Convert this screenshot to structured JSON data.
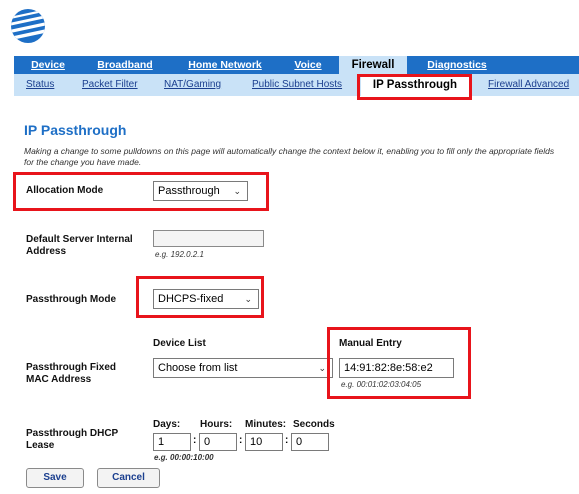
{
  "colors": {
    "brand": "#1e6fc6",
    "highlight": "#e8141b",
    "subnav_bg": "#c9e2f7"
  },
  "main_tabs": [
    {
      "label": "Device"
    },
    {
      "label": "Broadband"
    },
    {
      "label": "Home Network"
    },
    {
      "label": "Voice"
    },
    {
      "label": "Firewall",
      "active": true
    },
    {
      "label": "Diagnostics"
    }
  ],
  "sub_tabs": [
    {
      "label": "Status"
    },
    {
      "label": "Packet Filter"
    },
    {
      "label": "NAT/Gaming"
    },
    {
      "label": "Public Subnet Hosts"
    },
    {
      "label": "IP Passthrough",
      "active": true
    },
    {
      "label": "Firewall Advanced"
    }
  ],
  "page": {
    "title": "IP Passthrough",
    "intro": "Making a change to some pulldowns on this page will automatically change the context below it, enabling you to fill only the appropriate fields for the change you have made."
  },
  "form": {
    "allocation_mode": {
      "label": "Allocation Mode",
      "value": "Passthrough"
    },
    "default_server": {
      "label_line1": "Default Server Internal",
      "label_line2": "Address",
      "value": "",
      "hint": "e.g. 192.0.2.1"
    },
    "passthrough_mode": {
      "label": "Passthrough Mode",
      "value": "DHCPS-fixed"
    },
    "fixed_mac": {
      "label_line1": "Passthrough Fixed",
      "label_line2": "MAC Address",
      "device_list_header": "Device List",
      "device_list_value": "Choose from list",
      "manual_entry_header": "Manual Entry",
      "manual_entry_value": "14:91:82:8e:58:e2",
      "manual_entry_hint": "e.g. 00:01:02:03:04:05"
    },
    "dhcp_lease": {
      "label_line1": "Passthrough DHCP",
      "label_line2": "Lease",
      "days_label": "Days:",
      "hours_label": "Hours:",
      "minutes_label": "Minutes:",
      "seconds_label": "Seconds",
      "days": "1",
      "hours": "0",
      "minutes": "10",
      "seconds": "0",
      "colon": ":",
      "hint": "e.g. 00:00:10:00"
    }
  },
  "buttons": {
    "save": "Save",
    "cancel": "Cancel"
  },
  "icons": {
    "logo": "att-globe-logo",
    "dropdown": "chevron-down-icon"
  }
}
